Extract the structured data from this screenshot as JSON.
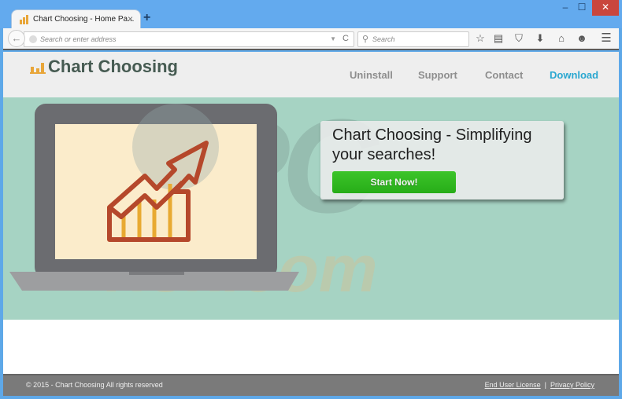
{
  "browser": {
    "tab": {
      "title": "Chart Choosing - Home Pa...",
      "close": "×"
    },
    "new_tab": "+",
    "window_controls": {
      "minimize": "–",
      "maximize": "☐",
      "close": "✕"
    },
    "toolbar": {
      "back": "←",
      "address_placeholder": "Search or enter address",
      "dropdown": "▼",
      "reload": "C",
      "search_placeholder": "Search",
      "search_glyph": "⚲",
      "icons": [
        {
          "name": "bookmark-star-icon",
          "glyph": "☆"
        },
        {
          "name": "reading-list-icon",
          "glyph": "▤"
        },
        {
          "name": "pocket-icon",
          "glyph": "⛉"
        },
        {
          "name": "download-icon",
          "glyph": "⬇"
        },
        {
          "name": "home-icon",
          "glyph": "⌂"
        },
        {
          "name": "chat-icon",
          "glyph": "☻"
        },
        {
          "name": "menu-icon",
          "glyph": "☰"
        }
      ]
    }
  },
  "site": {
    "logo_text": "Chart Choosing",
    "nav": [
      {
        "label": "Uninstall",
        "active": false
      },
      {
        "label": "Support",
        "active": false
      },
      {
        "label": "Contact",
        "active": false
      },
      {
        "label": "Download",
        "active": true
      }
    ],
    "hero": {
      "headline": "Chart Choosing - Simplifying your searches!",
      "cta": "Start Now!",
      "watermark_top": "PC",
      "watermark_bottom": "risk.com"
    },
    "footer": {
      "copyright": "© 2015 - Chart Choosing All rights reserved",
      "links": [
        "End User License",
        "Privacy Policy"
      ],
      "separator": "|"
    }
  },
  "colors": {
    "accent": "#2aa7d0",
    "cta_green": "#2db81d",
    "hero_bg": "#a6d3c3",
    "logo_orange": "#e8a63a",
    "logo_text": "#465b52"
  }
}
